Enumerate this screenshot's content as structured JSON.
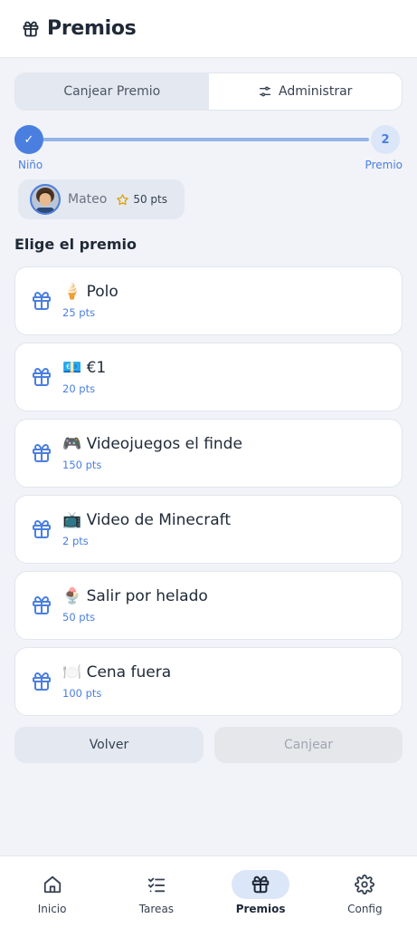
{
  "header": {
    "title": "Premios",
    "icon": "gift-icon"
  },
  "tabs": [
    {
      "label": "Canjear Premio",
      "active": true
    },
    {
      "label": "Administrar",
      "active": false,
      "icon": "sliders-icon"
    }
  ],
  "stepper": {
    "step1": {
      "mark": "✓",
      "label": "Niño"
    },
    "step2": {
      "mark": "2",
      "label": "Premio"
    }
  },
  "kid": {
    "name": "Mateo",
    "points": "50 pts"
  },
  "section_title": "Elige el premio",
  "rewards": [
    {
      "emoji": "🍦",
      "name": "Polo",
      "cost": "25 pts"
    },
    {
      "emoji": "💶",
      "name": "€1",
      "cost": "20 pts"
    },
    {
      "emoji": "🎮",
      "name": "Videojuegos el finde",
      "cost": "150 pts"
    },
    {
      "emoji": "📺",
      "name": "Video de Minecraft",
      "cost": "2 pts"
    },
    {
      "emoji": "🍨",
      "name": "Salir por helado",
      "cost": "50 pts"
    },
    {
      "emoji": "🍽️",
      "name": "Cena fuera",
      "cost": "100 pts"
    }
  ],
  "buttons": {
    "back": "Volver",
    "redeem": "Canjear"
  },
  "bottom_nav": [
    {
      "label": "Inicio",
      "icon": "home-icon"
    },
    {
      "label": "Tareas",
      "icon": "checklist-icon"
    },
    {
      "label": "Premios",
      "icon": "gift-icon",
      "active": true
    },
    {
      "label": "Config",
      "icon": "gear-icon"
    }
  ],
  "colors": {
    "accent": "#4a7fe0",
    "background": "#f1f3f8"
  }
}
